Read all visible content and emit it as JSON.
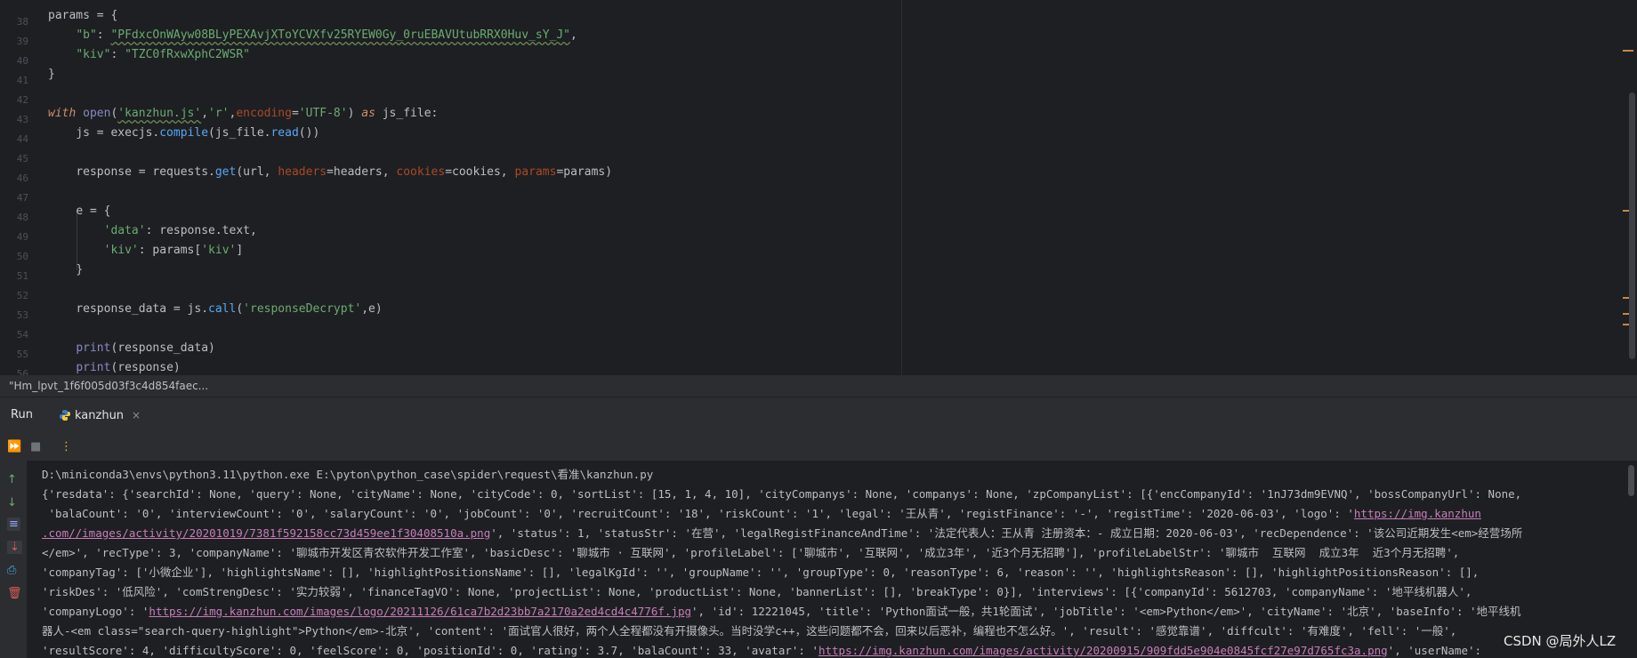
{
  "editor": {
    "line_numbers": [
      "",
      "38",
      "39",
      "40",
      "41",
      "42",
      "43",
      "44",
      "45",
      "46",
      "47",
      "48",
      "49",
      "50",
      "51",
      "52",
      "53",
      "54",
      "55",
      "56"
    ],
    "lines": {
      "l38": "params = {",
      "l39_key": "\"b\"",
      "l39_colon": ": ",
      "l39_val": "\"PFdxcOnWAyw08BLyPEXAvjXToYCVXfv25RYEW0Gy_0ruEBAVUtubRRX0Huv_sY_J\"",
      "l39_tail": ",",
      "l40_key": "\"kiv\"",
      "l40_colon": ": ",
      "l40_val": "\"TZC0fRxwXphC2WSR\"",
      "l41": "}",
      "l43_with": "with",
      "l43_open": "open",
      "l43_a": "(",
      "l43_file": "'kanzhun.js'",
      "l43_c1": ",",
      "l43_mode": "'r'",
      "l43_c2": ",",
      "l43_enc": "encoding",
      "l43_eq": "=",
      "l43_utf": "'UTF-8'",
      "l43_b": ") ",
      "l43_as": "as",
      "l43_tail": " js_file:",
      "l44_a": "js = execjs.",
      "l44_fn": "compile",
      "l44_b": "(js_file.",
      "l44_fn2": "read",
      "l44_c": "())",
      "l46_a": "response = requests.",
      "l46_fn": "get",
      "l46_b": "(url, ",
      "l46_p1": "headers",
      "l46_c": "=headers, ",
      "l46_p2": "cookies",
      "l46_d": "=cookies, ",
      "l46_p3": "params",
      "l46_e": "=params)",
      "l48": "e = {",
      "l49_key": "'data'",
      "l49_tail": ": response.text,",
      "l50_key": "'kiv'",
      "l50_a": ": params[",
      "l50_idx": "'kiv'",
      "l50_b": "]",
      "l51": "}",
      "l53_a": "response_data = js.",
      "l53_fn": "call",
      "l53_b": "(",
      "l53_arg": "'responseDecrypt'",
      "l53_c": ",e)",
      "l55_fn": "print",
      "l55_tail": "(response_data)",
      "l56_fn": "print",
      "l56_tail": "(response)"
    }
  },
  "hint_text": "\"Hm_lpvt_1f6f005d03f3c4d854faec...",
  "run_panel": {
    "title": "Run",
    "tab_label": "kanzhun",
    "close_glyph": "×"
  },
  "console": {
    "cmd": "D:\\miniconda3\\envs\\python3.11\\python.exe E:\\pyton\\python_case\\spider\\request\\看准\\kanzhun.py",
    "o1": "{'resdata': {'searchId': None, 'query': None, 'cityName': None, 'cityCode': 0, 'sortList': [15, 1, 4, 10], 'cityCompanys': None, 'companys': None, 'zpCompanyList': [{'encCompanyId': '1nJ73dm9EVNQ', 'bossCompanyUrl': None,",
    "o2a": " 'balaCount': '0', 'interviewCount': '0', 'salaryCount': '0', 'jobCount': '0', 'recruitCount': '18', 'riskCount': '1', 'legal': '王从青', 'registFinance': '-', 'registTime': '2020-06-03', 'logo': '",
    "o2link": "https://img.kanzhun",
    "o3link": ".com//images/activity/20201019/7381f592158cc73d459ee1f30408510a.png",
    "o3b": "', 'status': 1, 'statusStr': '在营', 'legalRegistFinanceAndTime': '法定代表人：王从青 注册资本：- 成立日期：2020-06-03', 'recDependence': '该公司近期发生<em>经营场所",
    "o4": "</em>', 'recType': 3, 'companyName': '聊城市开发区青农软件开发工作室', 'basicDesc': '聊城市 · 互联网', 'profileLabel': ['聊城市', '互联网', '成立3年', '近3个月无招聘'], 'profileLabelStr': '聊城市  互联网  成立3年  近3个月无招聘',",
    "o5": "'companyTag': ['小微企业'], 'highlightsName': [], 'highlightPositionsName': [], 'legalKgId': '', 'groupName': '', 'groupType': 0, 'reasonType': 6, 'reason': '', 'highlightsReason': [], 'highlightPositionsReason': [],",
    "o6": "'riskDes': '低风险', 'comStrengDesc': '实力较弱', 'financeTagVO': None, 'projectList': None, 'productList': None, 'bannerList': [], 'breakType': 0}], 'interviews': [{'companyId': 5612703, 'companyName': '地平线机器人',",
    "o7a": "'companyLogo': '",
    "o7link": "https://img.kanzhun.com/images/logo/20211126/61ca7b2d23bb7a2170a2ed4cd4c4776f.jpg",
    "o7b": "', 'id': 12221045, 'title': 'Python面试一般，共1轮面试', 'jobTitle': '<em>Python</em>', 'cityName': '北京', 'baseInfo': '地平线机",
    "o8": "器人-<em class=\"search-query-highlight\">Python</em>-北京', 'content': '面试官人很好，两个人全程都没有开摄像头。当时没学c++，这些问题都不会，回来以后恶补，编程也不怎么好。', 'result': '感觉靠谱', 'diffcult': '有难度', 'fell': '一般',",
    "o9a": "'resultScore': 4, 'difficultyScore': 0, 'feelScore': 0, 'positionId': 0, 'rating': 3.7, 'balaCount': 33, 'avatar': '",
    "o9link": "https://img.kanzhun.com/images/activity/20200915/909fdd5e904e0845fcf27e97d765fc3a.png",
    "o9b": "', 'userName':"
  },
  "watermark": "CSDN @局外人LZ",
  "icons": {
    "rerun": "⏩",
    "stop": "■",
    "more": "⋮",
    "up": "↑",
    "down": "↓",
    "wrap": "≡",
    "scroll_end": "⇣",
    "print": "⎙",
    "trash": "🗑"
  }
}
